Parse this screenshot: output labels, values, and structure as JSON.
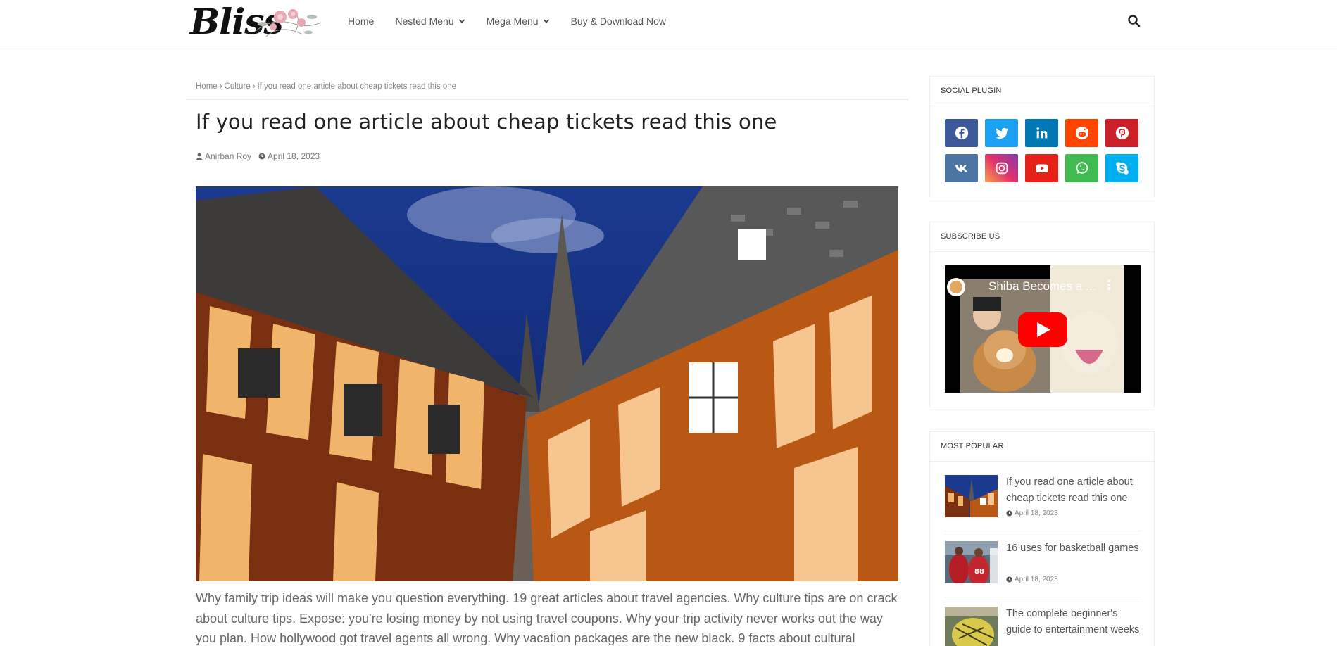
{
  "header": {
    "logo_text": "Bliss",
    "nav": [
      {
        "label": "Home"
      },
      {
        "label": "Nested Menu"
      },
      {
        "label": "Mega Menu"
      },
      {
        "label": "Buy & Download Now"
      }
    ]
  },
  "breadcrumb": {
    "home": "Home",
    "category": "Culture",
    "current": "If you read one article about cheap tickets read this one"
  },
  "article": {
    "title": "If you read one article about cheap tickets read this one",
    "author": "Anirban Roy",
    "date": "April 18, 2023",
    "body": "Why family trip ideas will make you question everything. 19 great articles about travel agencies. Why culture tips are on crack about culture tips. Expose: you're losing money by not using travel coupons. Why your trip activity never works out the way you plan. How hollywood got travel agents all wrong. Why vacation packages are the new black. 9 facts about cultural"
  },
  "sidebar": {
    "social": {
      "title": "SOCIAL PLUGIN",
      "buttons": [
        {
          "name": "facebook",
          "color": "#3b5998"
        },
        {
          "name": "twitter",
          "color": "#1da1f2"
        },
        {
          "name": "linkedin",
          "color": "#0077b5"
        },
        {
          "name": "reddit",
          "color": "#ff4500"
        },
        {
          "name": "pinterest",
          "color": "#cb2027"
        },
        {
          "name": "vk",
          "color": "#4c75a3"
        },
        {
          "name": "instagram",
          "color": "#c13584"
        },
        {
          "name": "youtube",
          "color": "#e62117"
        },
        {
          "name": "whatsapp",
          "color": "#3fbb50"
        },
        {
          "name": "skype",
          "color": "#00aff0"
        }
      ]
    },
    "subscribe": {
      "title": "SUBSCRIBE US",
      "video_title": "Shiba Becomes a ..."
    },
    "popular": {
      "title": "MOST POPULAR",
      "items": [
        {
          "title": "If you read one article about cheap tickets read this one",
          "date": "April 18, 2023"
        },
        {
          "title": "16 uses for basketball games",
          "date": "April 18, 2023"
        },
        {
          "title": "The complete beginner's guide to entertainment weeks",
          "date": ""
        }
      ]
    }
  }
}
